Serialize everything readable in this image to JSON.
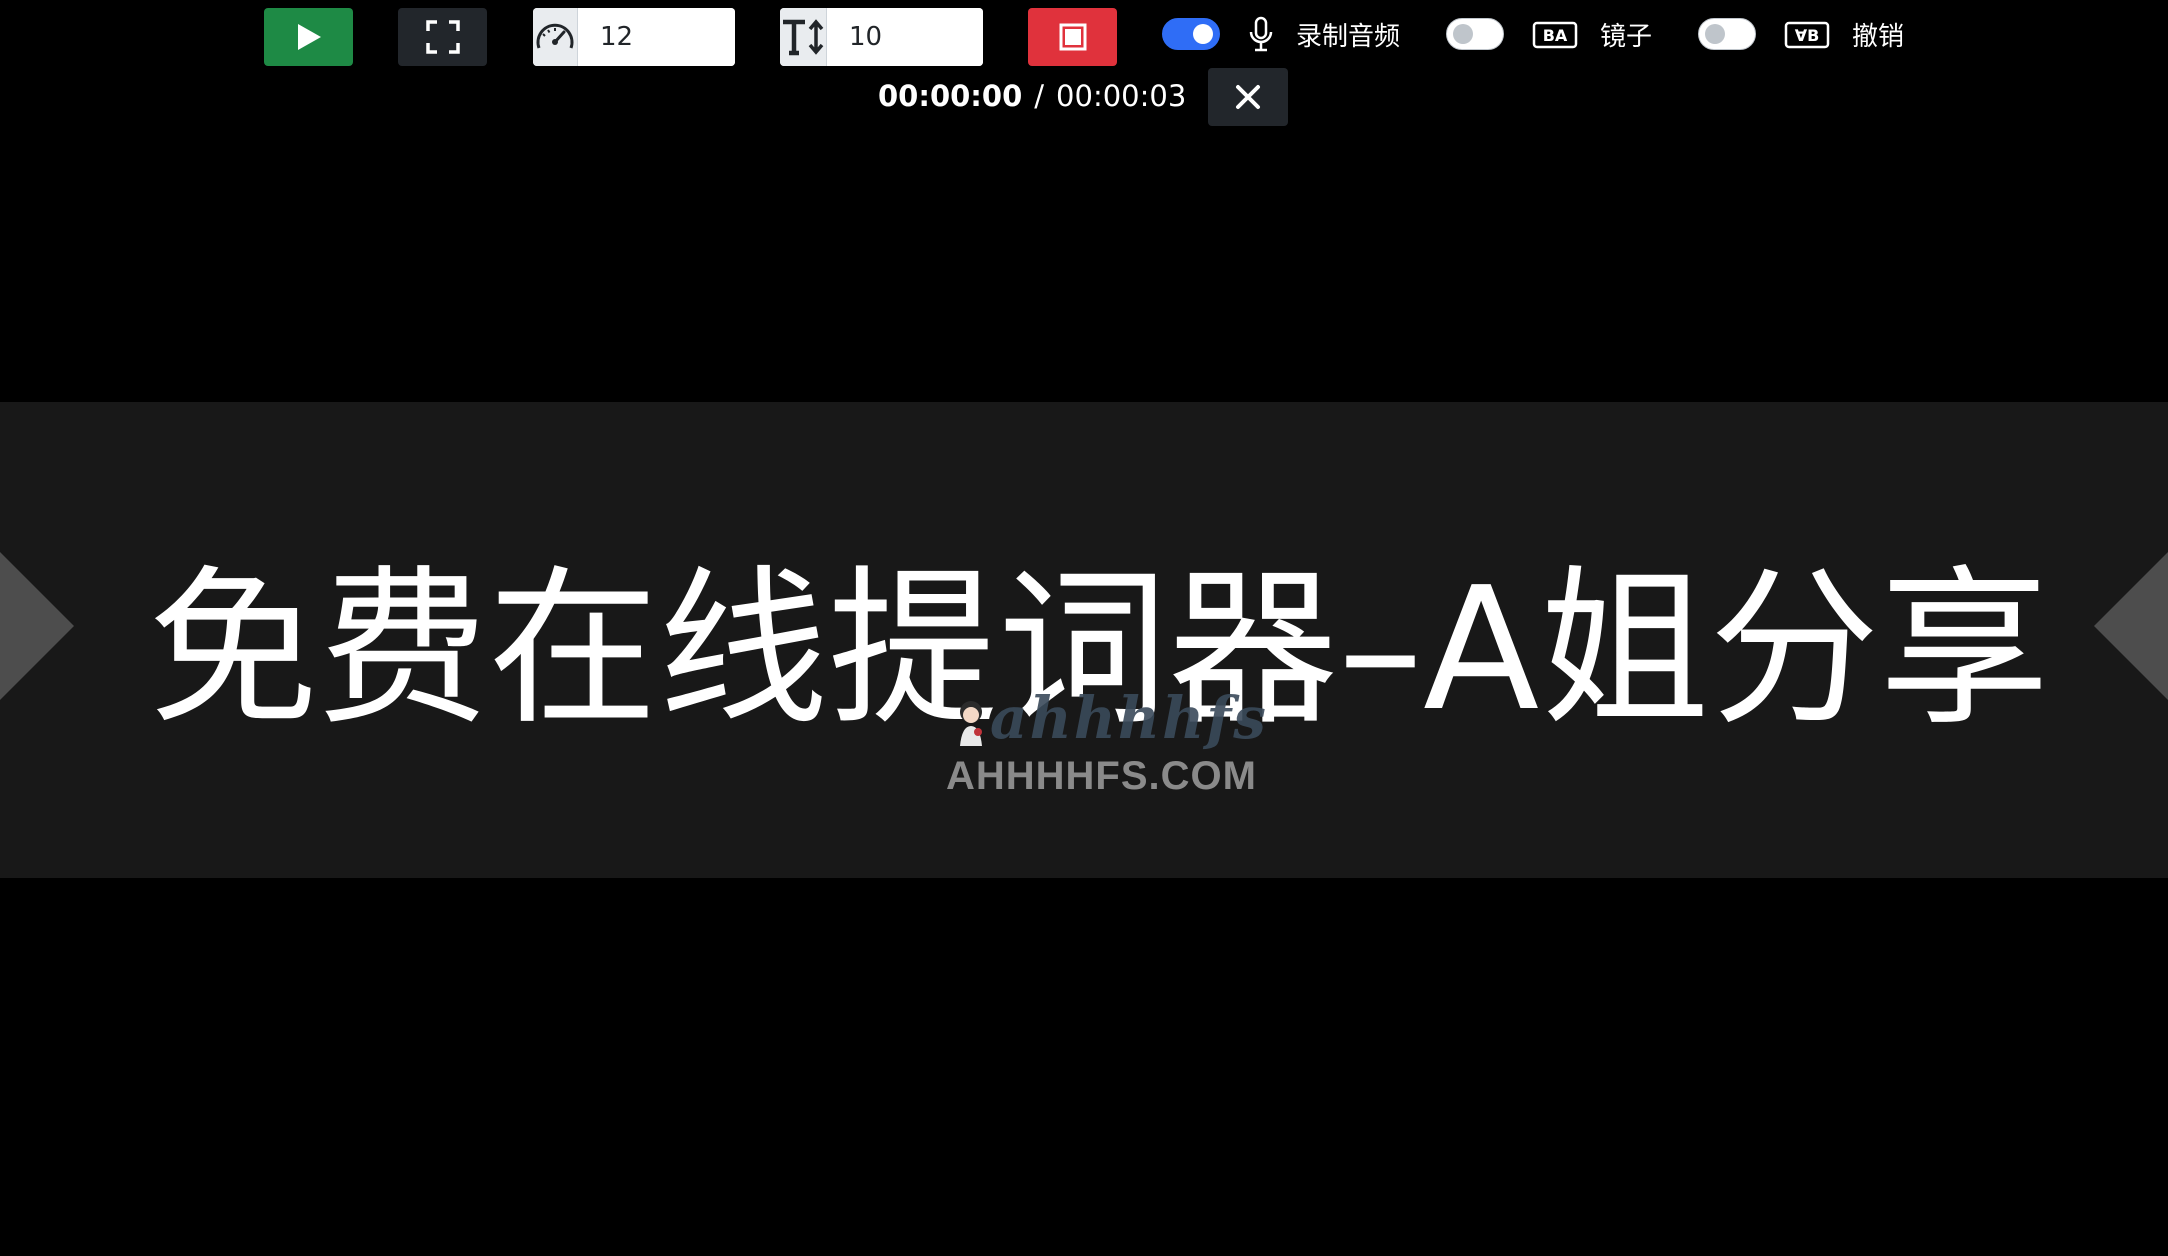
{
  "toolbar": {
    "play": {
      "icon": "play-icon"
    },
    "fullscreen": {
      "icon": "fullscreen-icon"
    },
    "speed": {
      "icon": "speedometer-icon",
      "value": "12"
    },
    "font_size": {
      "icon": "text-size-icon",
      "value": "10"
    },
    "record": {
      "icon": "stop-icon"
    },
    "record_audio": {
      "enabled": true,
      "icon": "microphone-icon",
      "label": "录制音频"
    },
    "mirror": {
      "enabled": false,
      "icon": "mirror-text-icon",
      "label": "镜子"
    },
    "reverse": {
      "enabled": false,
      "icon": "flip-text-icon",
      "label": "撤销"
    }
  },
  "timer": {
    "elapsed": "00:00:00",
    "separator": "/",
    "total": "00:00:03"
  },
  "close": {
    "icon": "close-icon"
  },
  "prompter": {
    "text": "免费在线提词器–A姐分享",
    "prev_icon": "chevron-left-icon",
    "next_icon": "chevron-right-icon"
  },
  "watermark": {
    "script": "ahhhhfs",
    "url": "AHHHHFS.COM"
  },
  "colors": {
    "play": "#1e8a45",
    "record": "#e0323c",
    "toggle_on": "#2f6df6",
    "band": "#181818"
  }
}
